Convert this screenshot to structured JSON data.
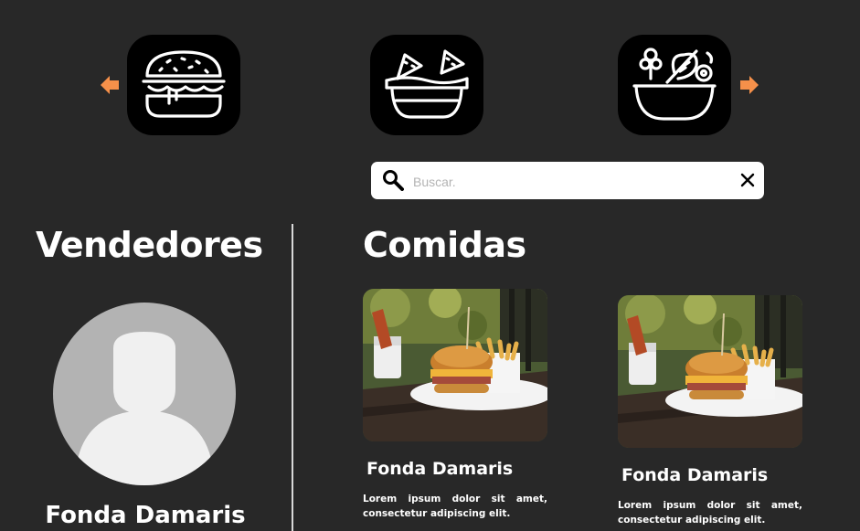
{
  "categories": {
    "prev_icon": "arrow-left-icon",
    "next_icon": "arrow-right-icon",
    "items": [
      {
        "name": "Hamburguesas",
        "icon": "burger-icon"
      },
      {
        "name": "Snacks",
        "icon": "nachos-bowl-icon"
      },
      {
        "name": "Ensaladas",
        "icon": "salad-bowl-icon"
      }
    ]
  },
  "search": {
    "placeholder": "Buscar.",
    "value": ""
  },
  "vendors": {
    "heading": "Vendedores",
    "items": [
      {
        "name": "Fonda Damaris"
      }
    ]
  },
  "foods": {
    "heading": "Comidas",
    "items": [
      {
        "vendor": "Fonda Damaris",
        "description": "Lorem ipsum dolor sit amet, consectetur adipiscing elit."
      },
      {
        "vendor": "Fonda Damaris",
        "description": "Lorem ipsum dolor sit amet, consectetur adipiscing elit."
      }
    ]
  },
  "colors": {
    "background": "#282828",
    "accent": "#f5904a",
    "tile": "#000000",
    "avatar_bg": "#b3b3b3",
    "avatar_fg": "#f0f0f0"
  }
}
